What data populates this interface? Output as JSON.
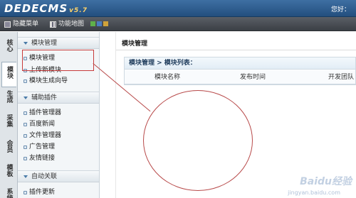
{
  "header": {
    "logo": "DEDECMS",
    "version": "v5.7",
    "greeting": "您好："
  },
  "toolbar": {
    "hide_menu": "隐藏菜单",
    "function_map": "功能地图",
    "theme_colors": [
      "#5fb04a",
      "#4a7cc0",
      "#cfa23a"
    ]
  },
  "vtabs": [
    "核心",
    "模块",
    "生成",
    "采集",
    "会员",
    "模板",
    "系统"
  ],
  "sidebar": {
    "groups": [
      {
        "title": "模块管理",
        "items": [
          "模块管理",
          "上传新模块",
          "模块生成向导"
        ]
      },
      {
        "title": "辅助插件",
        "items": [
          "插件管理器",
          "百度新闻",
          "文件管理器",
          "广告管理",
          "友情链接"
        ]
      },
      {
        "title": "自动关联",
        "items": [
          "插件更新"
        ]
      }
    ]
  },
  "main": {
    "title": "模块管理",
    "breadcrumb": "模块管理 > 模块列表：",
    "columns": [
      "模块名称",
      "发布时间",
      "开发团队"
    ]
  },
  "watermark": {
    "brand": "Baidu经验",
    "url": "jingyan.baidu.com"
  }
}
